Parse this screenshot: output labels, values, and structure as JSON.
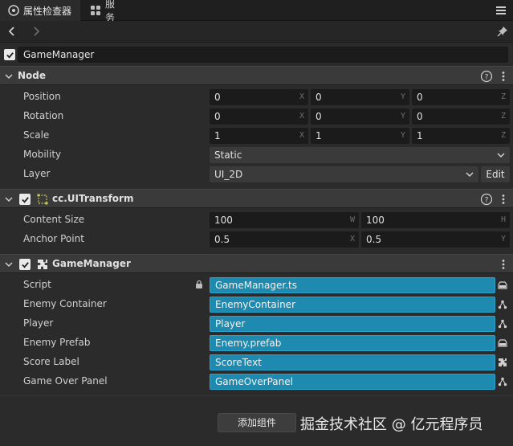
{
  "tabs": [
    {
      "label": "属性检查器",
      "icon": "inspector-icon"
    },
    {
      "label": "服务",
      "icon": "services-icon"
    }
  ],
  "node": {
    "enabled": true,
    "name": "GameManager"
  },
  "sections": {
    "node": {
      "title": "Node",
      "props": {
        "position": {
          "label": "Position",
          "x": "0",
          "y": "0",
          "z": "0"
        },
        "rotation": {
          "label": "Rotation",
          "x": "0",
          "y": "0",
          "z": "0"
        },
        "scale": {
          "label": "Scale",
          "x": "1",
          "y": "1",
          "z": "1"
        },
        "mobility": {
          "label": "Mobility",
          "value": "Static"
        },
        "layer": {
          "label": "Layer",
          "value": "UI_2D",
          "edit_label": "Edit"
        }
      }
    },
    "uitransform": {
      "title": "cc.UITransform",
      "props": {
        "content_size": {
          "label": "Content Size",
          "w": "100",
          "h": "100"
        },
        "anchor_point": {
          "label": "Anchor Point",
          "x": "0.5",
          "y": "0.5"
        }
      }
    },
    "gamemanager": {
      "title": "GameManager",
      "props": {
        "script": {
          "label": "Script",
          "value": "GameManager.ts"
        },
        "enemy_container": {
          "label": "Enemy Container",
          "value": "EnemyContainer"
        },
        "player": {
          "label": "Player",
          "value": "Player"
        },
        "enemy_prefab": {
          "label": "Enemy Prefab",
          "value": "Enemy.prefab"
        },
        "score_label": {
          "label": "Score Label",
          "value": "ScoreText"
        },
        "game_over_panel": {
          "label": "Game Over Panel",
          "value": "GameOverPanel"
        }
      }
    }
  },
  "axis_letters": {
    "x": "X",
    "y": "Y",
    "z": "Z",
    "w": "W",
    "h": "H"
  },
  "footer": {
    "add_component": "添加组件",
    "watermark": "掘金技术社区 @ 亿元程序员"
  },
  "colors": {
    "asset_field": "#1e8ab0",
    "panel_bg": "#2b2b2b",
    "header_bg": "#3a3a3a"
  }
}
